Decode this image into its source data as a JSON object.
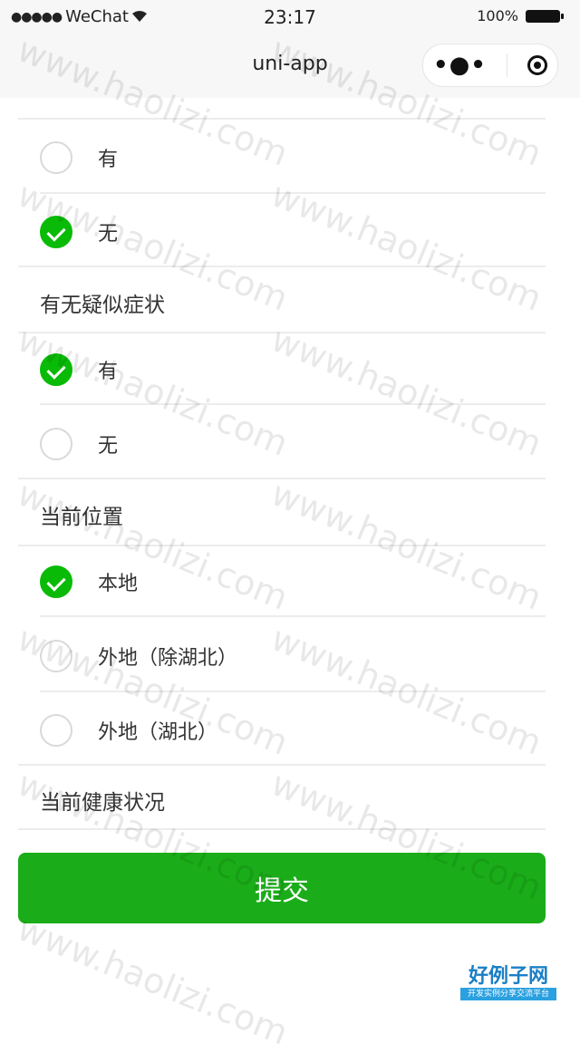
{
  "status_bar": {
    "signal": "●●●●●",
    "carrier": "WeChat",
    "wifi_icon": "wifi-icon",
    "time": "23:17",
    "battery_text": "100%"
  },
  "nav": {
    "title": "uni-app",
    "more_icon": "•●•",
    "close_icon": "target-circle-icon"
  },
  "sections": {
    "s1": {
      "options": [
        {
          "label": "有",
          "checked": false
        },
        {
          "label": "无",
          "checked": true
        }
      ]
    },
    "s2": {
      "title": "有无疑似症状",
      "options": [
        {
          "label": "有",
          "checked": true
        },
        {
          "label": "无",
          "checked": false
        }
      ]
    },
    "s3": {
      "title": "当前位置",
      "options": [
        {
          "label": "本地",
          "checked": true
        },
        {
          "label": "外地（除湖北）",
          "checked": false
        },
        {
          "label": "外地（湖北）",
          "checked": false
        }
      ]
    },
    "s4": {
      "title": "当前健康状况"
    }
  },
  "submit_label": "提交",
  "watermark_text": "www.haolizi.com",
  "logo": {
    "main": "好例子网",
    "sub": "开发实例分享交流平台"
  },
  "colors": {
    "accent": "#09bb07",
    "button": "#1aad19"
  }
}
